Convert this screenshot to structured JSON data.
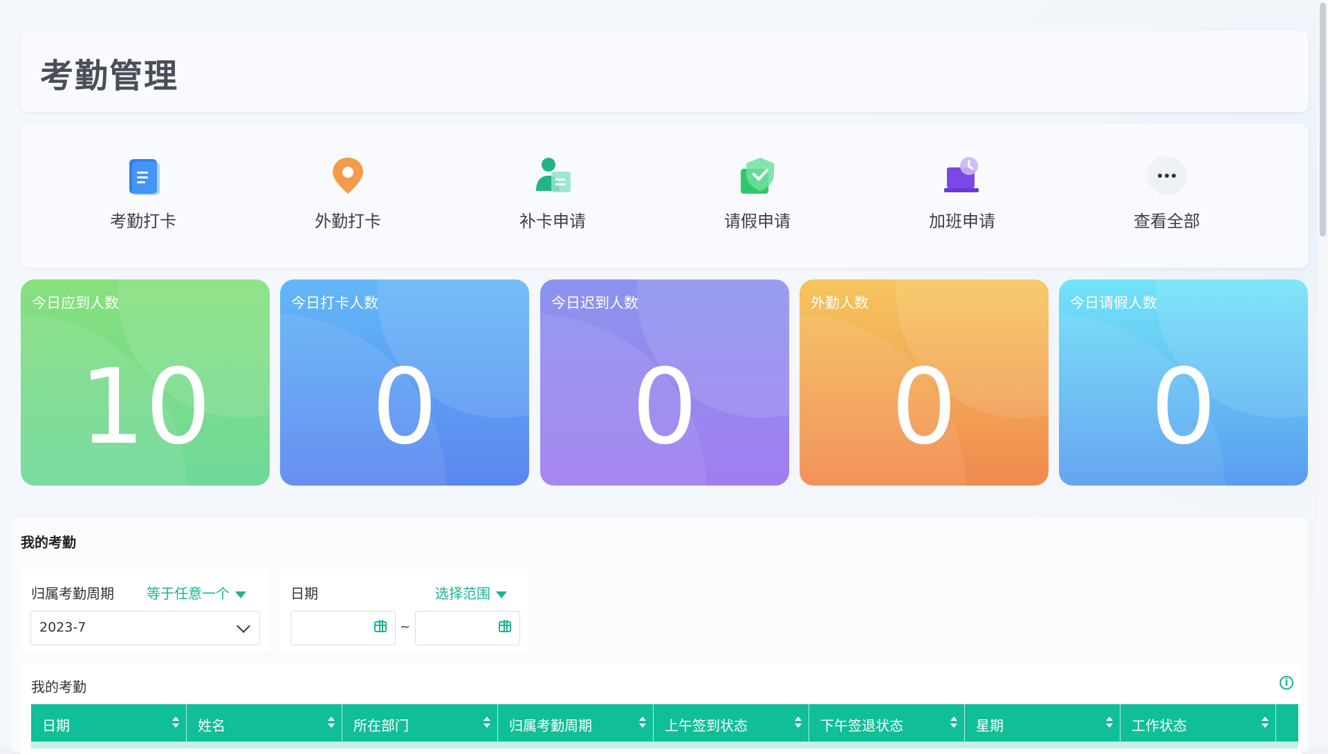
{
  "page": {
    "title": "考勤管理"
  },
  "apps": [
    {
      "label": "考勤打卡",
      "icon": "checkin-doc-icon"
    },
    {
      "label": "外勤打卡",
      "icon": "location-pin-icon"
    },
    {
      "label": "补卡申请",
      "icon": "user-card-icon"
    },
    {
      "label": "请假申请",
      "icon": "shield-check-icon"
    },
    {
      "label": "加班申请",
      "icon": "laptop-clock-icon"
    },
    {
      "label": "查看全部",
      "icon": "more-dots-icon"
    }
  ],
  "stats": [
    {
      "title": "今日应到人数",
      "value": "10",
      "color_from": "#86e07c",
      "color_to": "#6fd89a"
    },
    {
      "title": "今日打卡人数",
      "value": "0",
      "color_from": "#62b8f7",
      "color_to": "#5b86f0"
    },
    {
      "title": "今日迟到人数",
      "value": "0",
      "color_from": "#8c93ee",
      "color_to": "#a07ef0"
    },
    {
      "title": "外勤人数",
      "value": "0",
      "color_from": "#f6c55d",
      "color_to": "#f08a4f"
    },
    {
      "title": "今日请假人数",
      "value": "0",
      "color_from": "#72e3f8",
      "color_to": "#5a9df0"
    }
  ],
  "my_attendance": {
    "section_title": "我的考勤",
    "filters": {
      "period_label": "归属考勤周期",
      "period_operator": "等于任意一个",
      "period_value": "2023-7",
      "date_label": "日期",
      "date_operator": "选择范围",
      "date_separator": "~"
    },
    "table": {
      "title": "我的考勤",
      "columns": [
        "日期",
        "姓名",
        "所在部门",
        "归属考勤周期",
        "上午签到状态",
        "下午签退状态",
        "星期",
        "工作状态"
      ]
    }
  },
  "colors": {
    "accent": "#10bf97"
  }
}
